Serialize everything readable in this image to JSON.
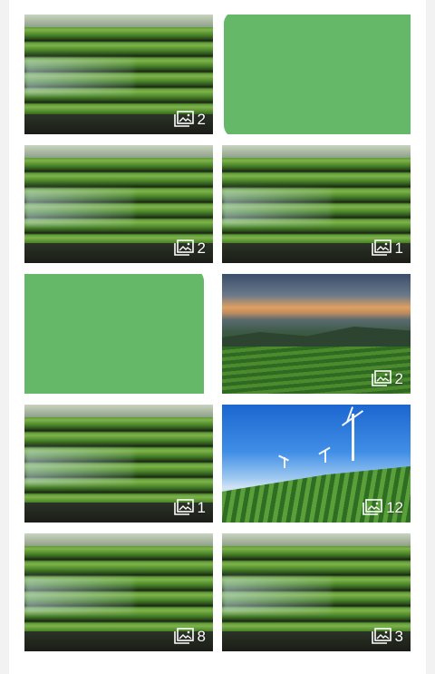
{
  "accent_green": "#64b868",
  "gallery": {
    "tiles": [
      {
        "image": "lettuce-field",
        "count": "2"
      },
      {
        "image": "redacted",
        "count": ""
      },
      {
        "image": "lettuce-field",
        "count": "2"
      },
      {
        "image": "lettuce-field",
        "count": "1"
      },
      {
        "image": "redacted",
        "count": ""
      },
      {
        "image": "hills-landscape",
        "count": "2"
      },
      {
        "image": "lettuce-field",
        "count": "1"
      },
      {
        "image": "windmill-field",
        "count": "12"
      },
      {
        "image": "lettuce-field",
        "count": "8"
      },
      {
        "image": "lettuce-field",
        "count": "3"
      }
    ],
    "badge_icon": "image-stack-icon"
  }
}
